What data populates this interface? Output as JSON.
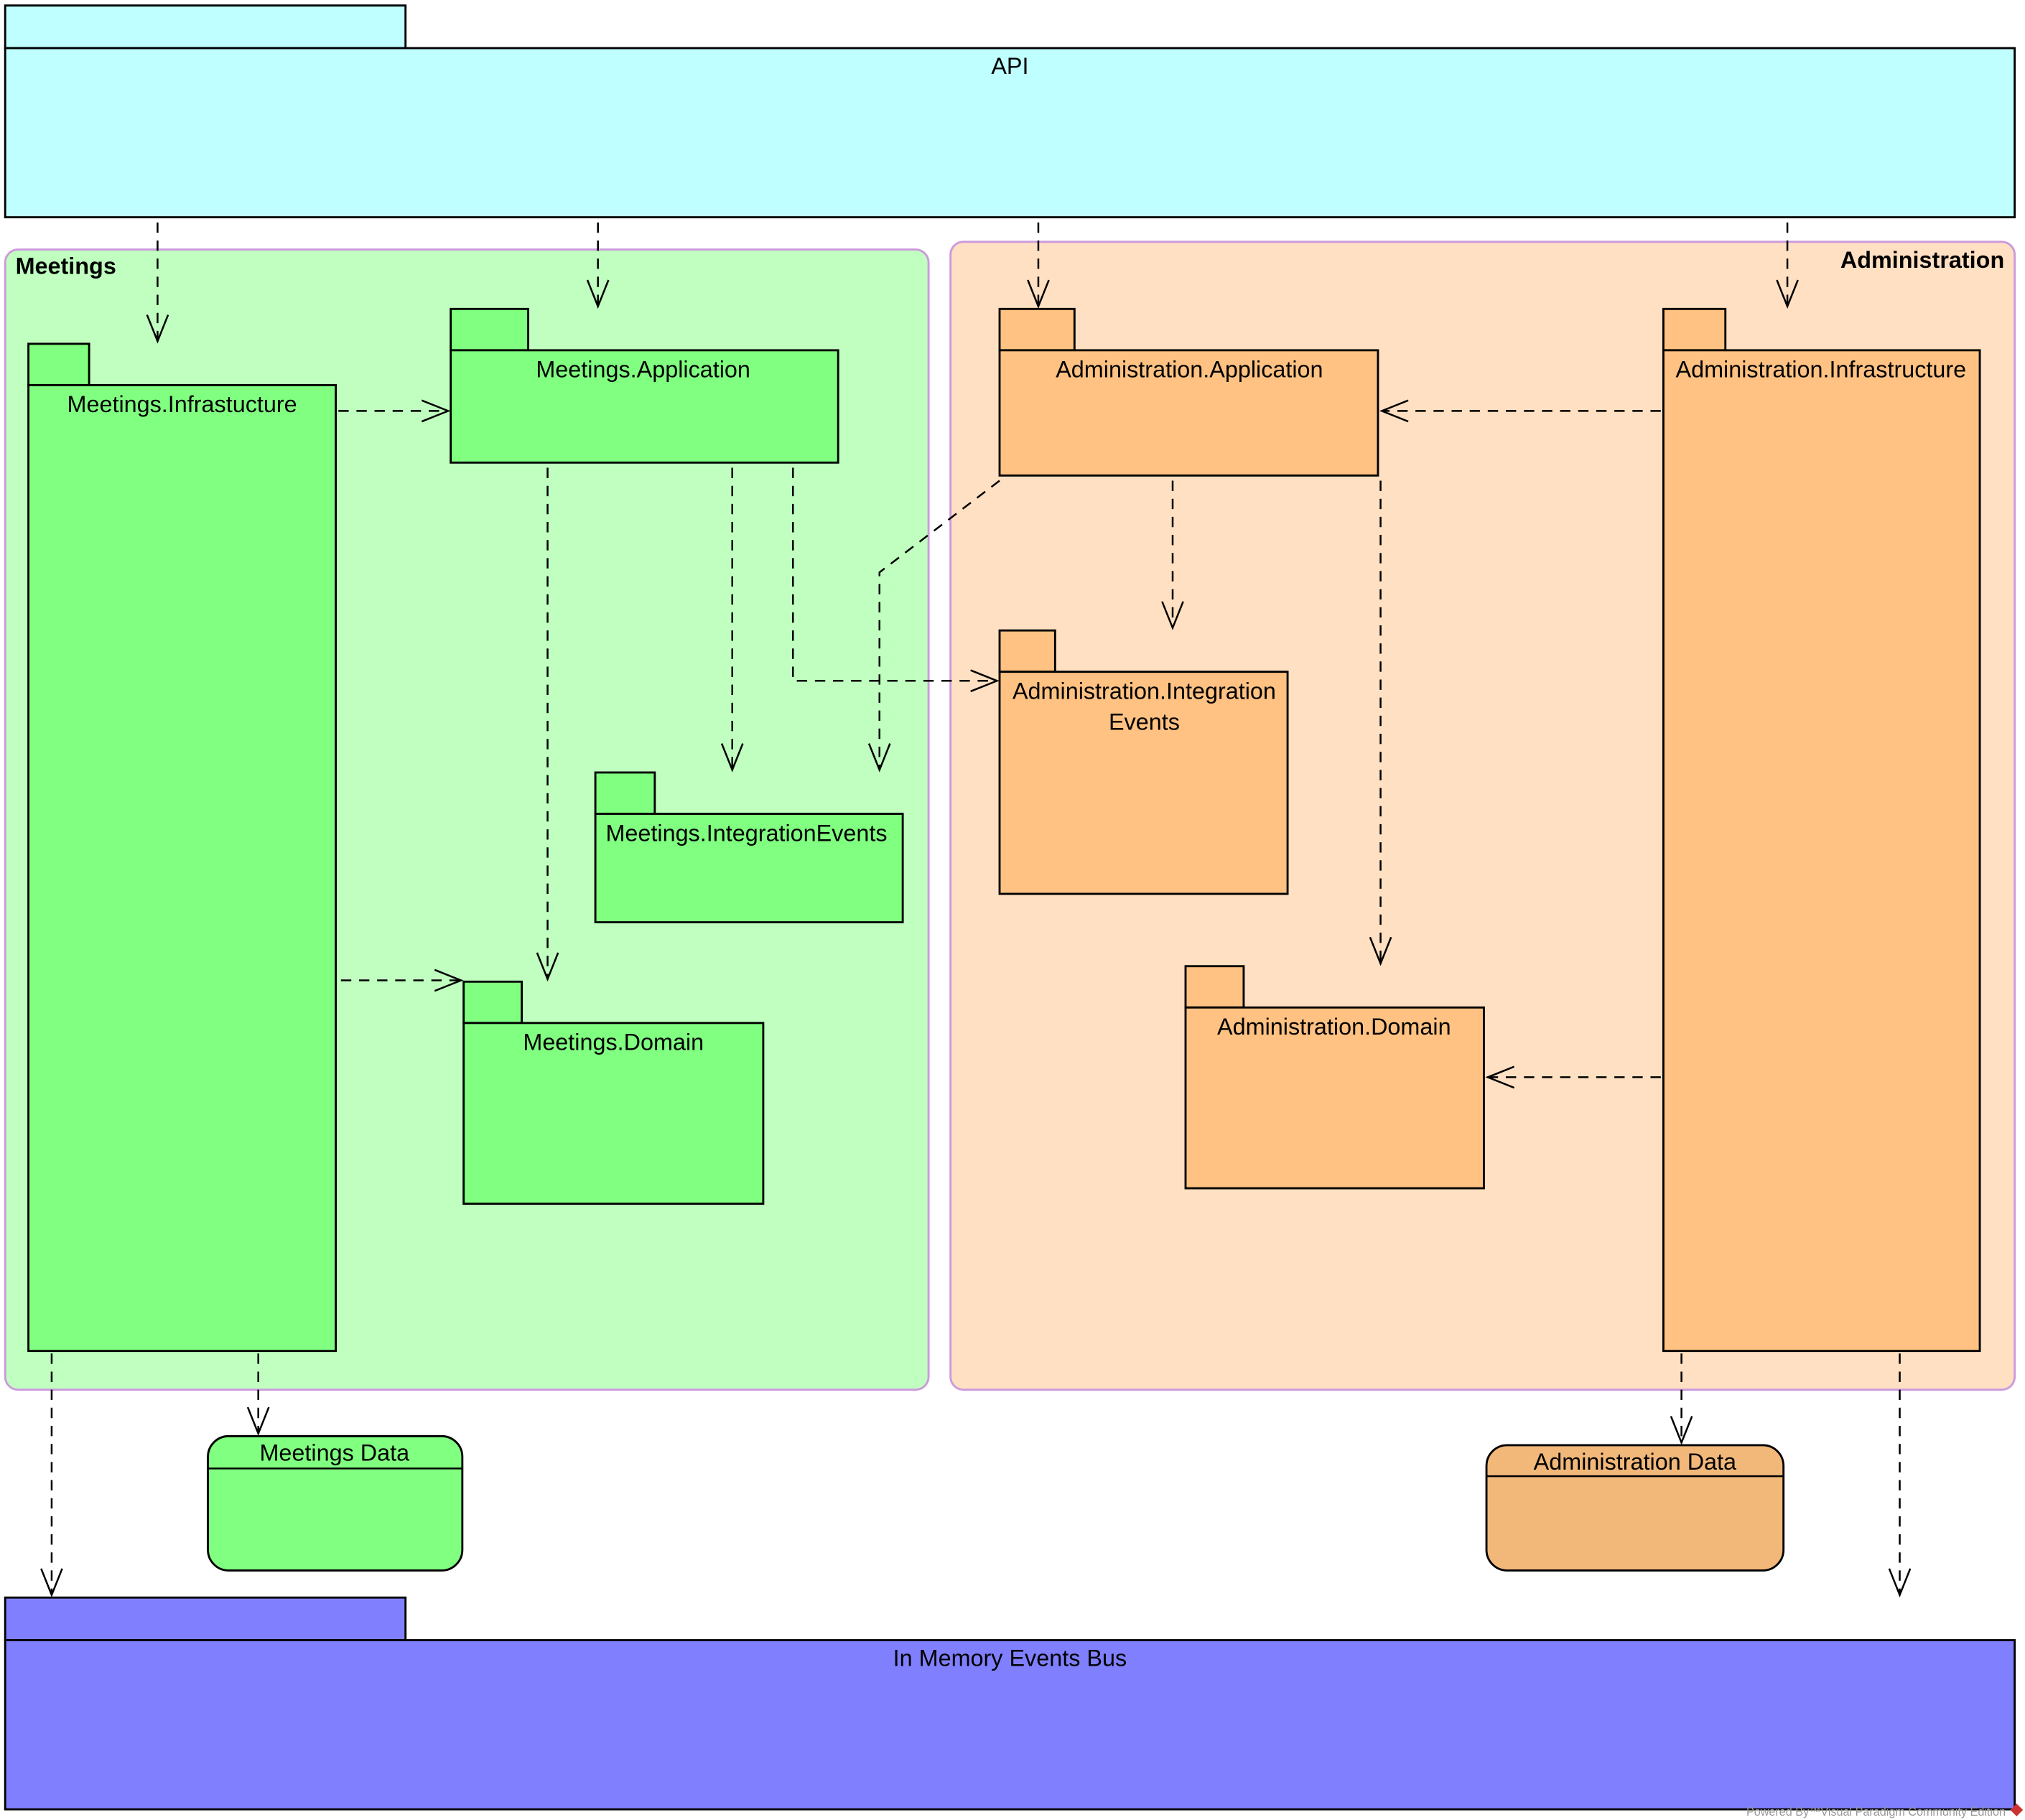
{
  "diagram": {
    "type": "UML package diagram",
    "colors": {
      "api": "#C0FFFF",
      "meetings_group": "#C0FFC0",
      "meetings_package": "#80FF80",
      "administration_group": "#FFE0C2",
      "administration_package": "#FFC282",
      "administration_data": "#F2B87A",
      "event_bus": "#8080FF",
      "group_border": "#CC99DD"
    },
    "top_package": {
      "label": "API"
    },
    "bottom_package": {
      "label": "In Memory Events Bus"
    },
    "groups": [
      {
        "label": "Meetings",
        "packages": [
          {
            "id": "m_infra",
            "label": "Meetings.Infrastucture"
          },
          {
            "id": "m_app",
            "label": "Meetings.Application"
          },
          {
            "id": "m_int",
            "label": "Meetings.IntegrationEvents"
          },
          {
            "id": "m_dom",
            "label": "Meetings.Domain"
          }
        ]
      },
      {
        "label": "Administration",
        "packages": [
          {
            "id": "a_app",
            "label": "Administration.Application"
          },
          {
            "id": "a_infra",
            "label": "Administration.Infrastructure"
          },
          {
            "id": "a_int",
            "label": "Administration.Integration",
            "label_line2": "Events"
          },
          {
            "id": "a_dom",
            "label": "Administration.Domain"
          }
        ]
      }
    ],
    "data_stores": [
      {
        "id": "m_data",
        "label": "Meetings Data"
      },
      {
        "id": "a_data",
        "label": "Administration Data"
      }
    ],
    "dependencies": [
      {
        "from": "API",
        "to": "Meetings.Infrastucture"
      },
      {
        "from": "API",
        "to": "Meetings.Application"
      },
      {
        "from": "API",
        "to": "Administration.Application"
      },
      {
        "from": "API",
        "to": "Administration.Infrastructure"
      },
      {
        "from": "Meetings.Infrastucture",
        "to": "Meetings.Application"
      },
      {
        "from": "Meetings.Infrastucture",
        "to": "Meetings.Domain"
      },
      {
        "from": "Meetings.Application",
        "to": "Meetings.Domain"
      },
      {
        "from": "Meetings.Application",
        "to": "Meetings.IntegrationEvents"
      },
      {
        "from": "Meetings.Application",
        "to": "Administration.IntegrationEvents"
      },
      {
        "from": "Administration.Application",
        "to": "Meetings.IntegrationEvents"
      },
      {
        "from": "Administration.Infrastructure",
        "to": "Administration.Application"
      },
      {
        "from": "Administration.Application",
        "to": "Administration.IntegrationEvents"
      },
      {
        "from": "Administration.Application",
        "to": "Administration.Domain"
      },
      {
        "from": "Administration.Infrastructure",
        "to": "Administration.Domain"
      },
      {
        "from": "Meetings.Infrastucture",
        "to": "In Memory Events Bus"
      },
      {
        "from": "Meetings.Infrastucture",
        "to": "Meetings Data"
      },
      {
        "from": "Administration.Infrastructure",
        "to": "Administration Data"
      },
      {
        "from": "Administration.Infrastructure",
        "to": "In Memory Events Bus"
      }
    ],
    "watermark": "Powered By™Visual Paradigm Community Edition"
  }
}
